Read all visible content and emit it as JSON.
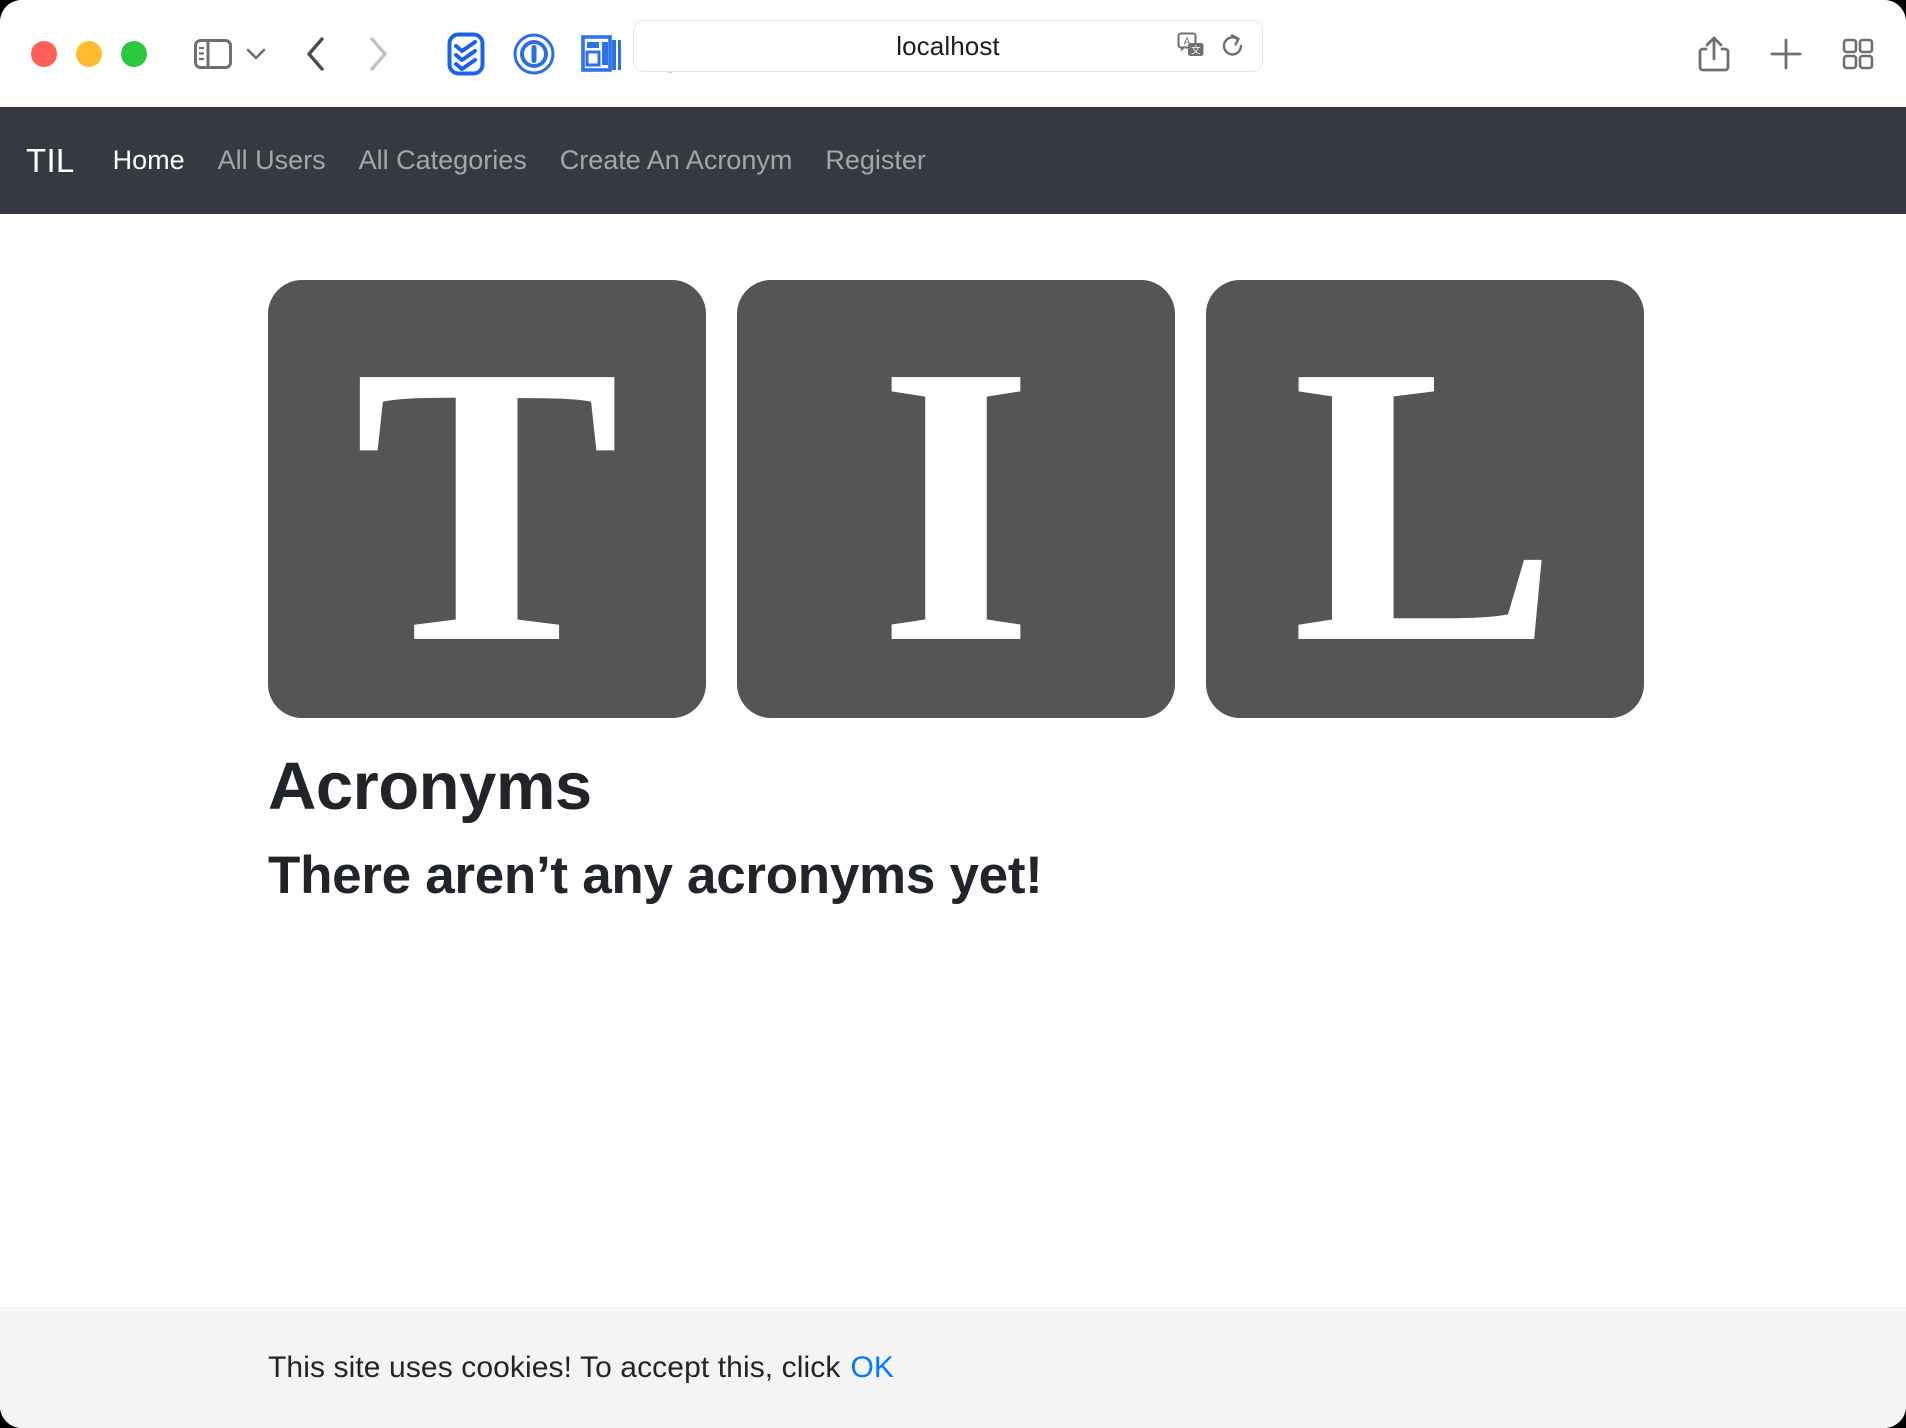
{
  "browser": {
    "url_value": "localhost",
    "traffic_lights": [
      {
        "name": "close",
        "color": "#ff5f57"
      },
      {
        "name": "minimize",
        "color": "#febc2e"
      },
      {
        "name": "maximize",
        "color": "#28c840"
      }
    ],
    "left_icons": [
      {
        "name": "sidebar-toggle-icon",
        "label": "Show Sidebar"
      },
      {
        "name": "chevron-down-icon",
        "label": "Sidebar Options"
      },
      {
        "name": "back-arrow-icon",
        "label": "Back"
      },
      {
        "name": "forward-arrow-icon",
        "label": "Forward"
      }
    ],
    "extension_icons": [
      {
        "name": "checklist-extension-icon",
        "color": "#1a73e8"
      },
      {
        "name": "password-manager-extension-icon",
        "color": "#2b6fe0"
      },
      {
        "name": "reader-layout-extension-icon",
        "color": "#2f72e8"
      },
      {
        "name": "privacy-shield-icon",
        "color": "#9a9a9e"
      }
    ],
    "urlbar_icons": [
      {
        "name": "translate-icon",
        "label": "Translate"
      },
      {
        "name": "reload-icon",
        "label": "Reload"
      }
    ],
    "right_icons": [
      {
        "name": "share-icon",
        "label": "Share"
      },
      {
        "name": "new-tab-icon",
        "label": "New Tab"
      },
      {
        "name": "tab-overview-icon",
        "label": "Tab Overview"
      }
    ]
  },
  "site_nav": {
    "brand": "TIL",
    "items": [
      {
        "label": "Home",
        "active": true
      },
      {
        "label": "All Users",
        "active": false
      },
      {
        "label": "All Categories",
        "active": false
      },
      {
        "label": "Create An Acronym",
        "active": false
      },
      {
        "label": "Register",
        "active": false
      }
    ],
    "background_color": "#343a40"
  },
  "main": {
    "logo_letters": [
      "T",
      "I",
      "L"
    ],
    "logo_tile_color": "#555555",
    "title": "Acronyms",
    "subtitle": "There aren’t any acronyms yet!"
  },
  "cookie_banner": {
    "message": "This site uses cookies! To accept this, click",
    "accept_label": "OK",
    "accent_color": "#007aff",
    "background_color": "#f4f4f5"
  }
}
